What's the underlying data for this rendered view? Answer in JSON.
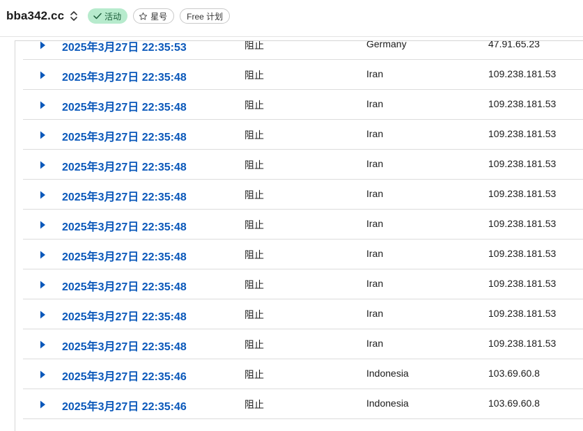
{
  "header": {
    "site_name": "bba342.cc",
    "status_label": "活动",
    "star_label": "星号",
    "plan_label": "Free 计划"
  },
  "colors": {
    "link_blue": "#0a58ba",
    "active_badge_bg": "#b7ebcd",
    "active_badge_text": "#1b5e3a"
  },
  "icons": {
    "site_switch": "chevron-up-down-icon",
    "status": "check-icon",
    "star": "star-outline-icon",
    "row_expand": "caret-right-icon"
  },
  "events": [
    {
      "time": "2025年3月27日 22:35:53",
      "action": "阻止",
      "country": "Germany",
      "ip": "47.91.65.23"
    },
    {
      "time": "2025年3月27日 22:35:48",
      "action": "阻止",
      "country": "Iran",
      "ip": "109.238.181.53"
    },
    {
      "time": "2025年3月27日 22:35:48",
      "action": "阻止",
      "country": "Iran",
      "ip": "109.238.181.53"
    },
    {
      "time": "2025年3月27日 22:35:48",
      "action": "阻止",
      "country": "Iran",
      "ip": "109.238.181.53"
    },
    {
      "time": "2025年3月27日 22:35:48",
      "action": "阻止",
      "country": "Iran",
      "ip": "109.238.181.53"
    },
    {
      "time": "2025年3月27日 22:35:48",
      "action": "阻止",
      "country": "Iran",
      "ip": "109.238.181.53"
    },
    {
      "time": "2025年3月27日 22:35:48",
      "action": "阻止",
      "country": "Iran",
      "ip": "109.238.181.53"
    },
    {
      "time": "2025年3月27日 22:35:48",
      "action": "阻止",
      "country": "Iran",
      "ip": "109.238.181.53"
    },
    {
      "time": "2025年3月27日 22:35:48",
      "action": "阻止",
      "country": "Iran",
      "ip": "109.238.181.53"
    },
    {
      "time": "2025年3月27日 22:35:48",
      "action": "阻止",
      "country": "Iran",
      "ip": "109.238.181.53"
    },
    {
      "time": "2025年3月27日 22:35:48",
      "action": "阻止",
      "country": "Iran",
      "ip": "109.238.181.53"
    },
    {
      "time": "2025年3月27日 22:35:46",
      "action": "阻止",
      "country": "Indonesia",
      "ip": "103.69.60.8"
    },
    {
      "time": "2025年3月27日 22:35:46",
      "action": "阻止",
      "country": "Indonesia",
      "ip": "103.69.60.8"
    }
  ]
}
